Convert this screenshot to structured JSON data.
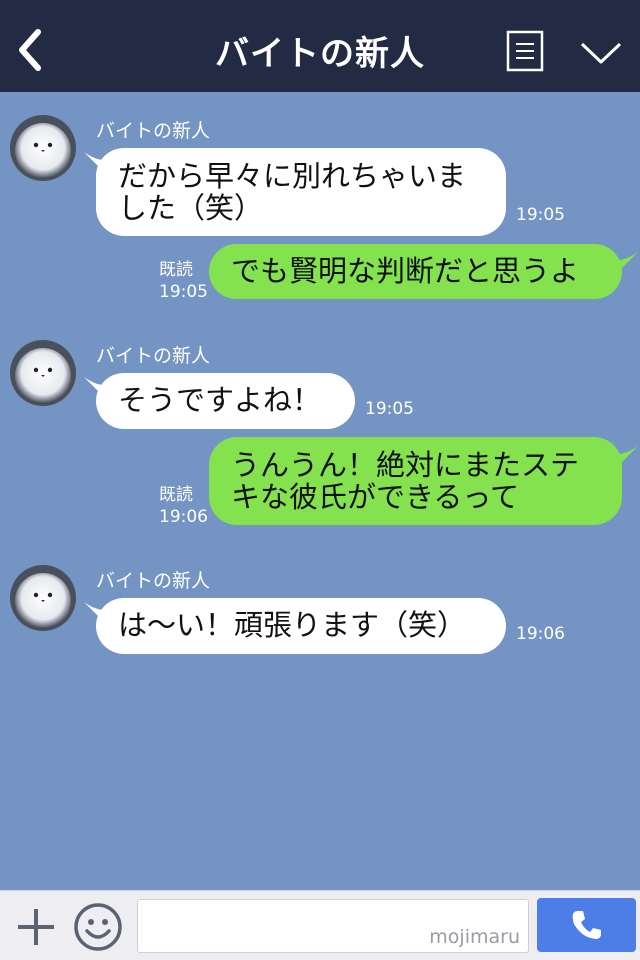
{
  "header": {
    "title": "バイトの新人"
  },
  "messages": [
    {
      "sender": "バイトの新人",
      "line1": "だから早々に別れちゃいま",
      "line2": "した（笑）",
      "time": "19:05"
    },
    {
      "read_label": "既読",
      "read_time": "19:05",
      "text": "でも賢明な判断だと思うよ"
    },
    {
      "sender": "バイトの新人",
      "text": "そうですよね！",
      "time": "19:05"
    },
    {
      "read_label": "既読",
      "read_time": "19:06",
      "line1": "うんうん！絶対にまたステ",
      "line2": "キな彼氏ができるって"
    },
    {
      "sender": "バイトの新人",
      "text": "は〜い！頑張ります（笑）",
      "time": "19:06"
    }
  ],
  "footer": {
    "watermark": "mojimaru",
    "input_value": ""
  },
  "colors": {
    "header_bg": "#232b44",
    "chat_bg": "#7494c3",
    "incoming_bubble": "#ffffff",
    "outgoing_bubble": "#84e24f",
    "call_button": "#4d7ee8"
  },
  "icons": [
    "back-arrow-icon",
    "menu-list-icon",
    "chevron-down-icon",
    "plus-icon",
    "smiley-icon",
    "phone-icon"
  ]
}
